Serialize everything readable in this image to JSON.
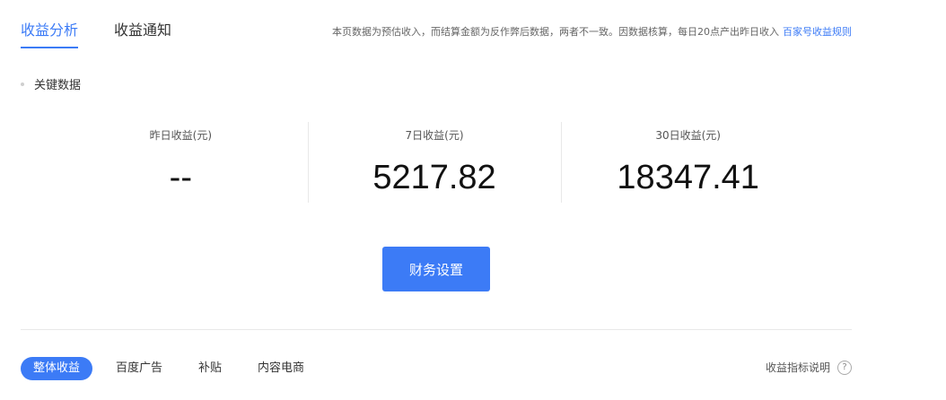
{
  "tabs": [
    {
      "label": "收益分析",
      "active": true
    },
    {
      "label": "收益通知",
      "active": false
    }
  ],
  "notice": {
    "text": "本页数据为预估收入，而结算金额为反作弊后数据，两者不一致。因数据核算，每日20点产出昨日收入",
    "link": "百家号收益规则"
  },
  "section_title": "关键数据",
  "metrics": [
    {
      "label": "昨日收益(元)",
      "value": "--"
    },
    {
      "label": "7日收益(元)",
      "value": "5217.82"
    },
    {
      "label": "30日收益(元)",
      "value": "18347.41"
    }
  ],
  "finance_button": "财务设置",
  "subtabs": [
    {
      "label": "整体收益",
      "active": true
    },
    {
      "label": "百度广告",
      "active": false
    },
    {
      "label": "补贴",
      "active": false
    },
    {
      "label": "内容电商",
      "active": false
    }
  ],
  "explain": {
    "label": "收益指标说明",
    "icon": "question-icon",
    "glyph": "?"
  },
  "colors": {
    "accent": "#3c7bf6",
    "divider": "#e9e9e9"
  }
}
